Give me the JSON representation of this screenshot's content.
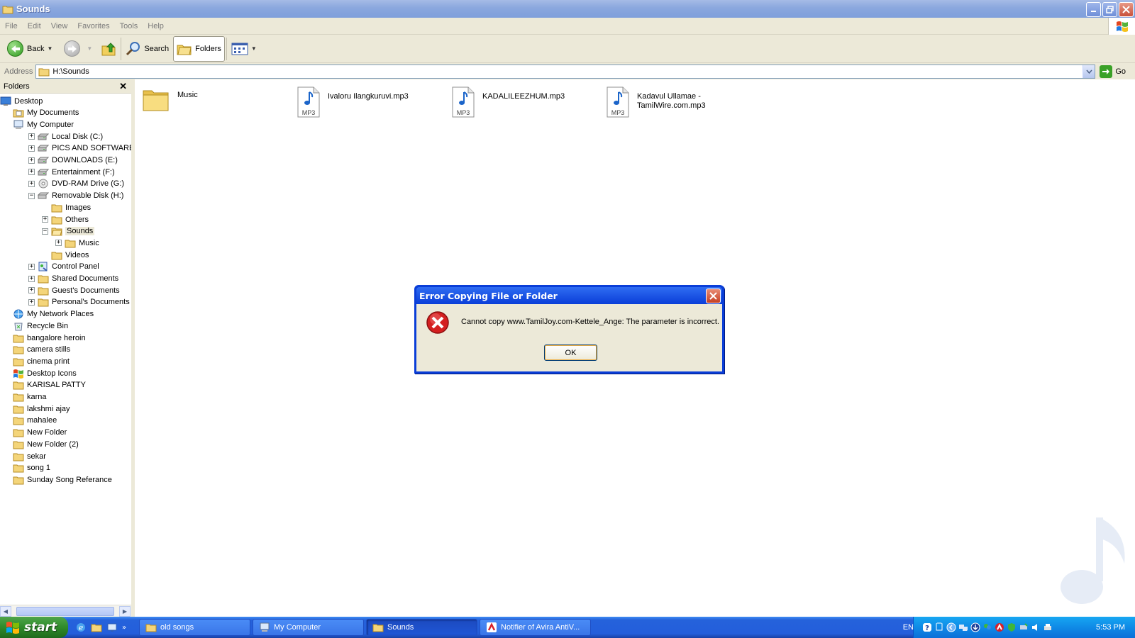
{
  "window": {
    "title": "Sounds",
    "menu": [
      "File",
      "Edit",
      "View",
      "Favorites",
      "Tools",
      "Help"
    ]
  },
  "toolbar": {
    "back_label": "Back",
    "search_label": "Search",
    "folders_label": "Folders"
  },
  "address": {
    "label": "Address",
    "value": "H:\\Sounds",
    "go_label": "Go"
  },
  "folders_pane": {
    "title": "Folders",
    "close_glyph": "✕",
    "items": [
      {
        "label": "Desktop",
        "icon": "desktop-icon",
        "expander": "",
        "level": 0
      },
      {
        "label": "My Documents",
        "icon": "my-documents-icon",
        "expander": "",
        "level": 1
      },
      {
        "label": "My Computer",
        "icon": "my-computer-icon",
        "expander": "",
        "level": 1
      },
      {
        "label": "Local Disk (C:)",
        "icon": "hard-drive-icon",
        "expander": "+",
        "level": 2
      },
      {
        "label": "PICS AND SOFTWARES (D:)",
        "icon": "hard-drive-icon",
        "expander": "+",
        "level": 2
      },
      {
        "label": "DOWNLOADS (E:)",
        "icon": "hard-drive-icon",
        "expander": "+",
        "level": 2
      },
      {
        "label": "Entertainment (F:)",
        "icon": "hard-drive-icon",
        "expander": "+",
        "level": 2
      },
      {
        "label": "DVD-RAM Drive (G:)",
        "icon": "dvd-drive-icon",
        "expander": "+",
        "level": 2
      },
      {
        "label": "Removable Disk (H:)",
        "icon": "removable-disk-icon",
        "expander": "−",
        "level": 2
      },
      {
        "label": "Images",
        "icon": "folder-icon",
        "expander": "",
        "level": 3
      },
      {
        "label": "Others",
        "icon": "folder-icon",
        "expander": "+",
        "level": 3
      },
      {
        "label": "Sounds",
        "icon": "folder-open-icon",
        "expander": "−",
        "level": 3
      },
      {
        "label": "Music",
        "icon": "folder-icon",
        "expander": "+",
        "level": 4
      },
      {
        "label": "Videos",
        "icon": "folder-icon",
        "expander": "",
        "level": 3
      },
      {
        "label": "Control Panel",
        "icon": "control-panel-icon",
        "expander": "+",
        "level": 2
      },
      {
        "label": "Shared Documents",
        "icon": "folder-icon",
        "expander": "+",
        "level": 2
      },
      {
        "label": "Guest's Documents",
        "icon": "folder-icon",
        "expander": "+",
        "level": 2
      },
      {
        "label": "Personal's Documents",
        "icon": "folder-icon",
        "expander": "+",
        "level": 2
      },
      {
        "label": "My Network Places",
        "icon": "network-places-icon",
        "expander": "",
        "level": 1
      },
      {
        "label": "Recycle Bin",
        "icon": "recycle-bin-icon",
        "expander": "",
        "level": 1
      },
      {
        "label": "bangalore heroin",
        "icon": "folder-icon",
        "expander": "",
        "level": 1
      },
      {
        "label": "camera stills",
        "icon": "folder-icon",
        "expander": "",
        "level": 1
      },
      {
        "label": "cinema print",
        "icon": "folder-icon",
        "expander": "",
        "level": 1
      },
      {
        "label": "Desktop Icons",
        "icon": "desktop-icons-icon",
        "expander": "",
        "level": 1
      },
      {
        "label": "KARISAL PATTY",
        "icon": "folder-icon",
        "expander": "",
        "level": 1
      },
      {
        "label": "karna",
        "icon": "folder-icon",
        "expander": "",
        "level": 1
      },
      {
        "label": "lakshmi ajay",
        "icon": "folder-icon",
        "expander": "",
        "level": 1
      },
      {
        "label": "mahalee",
        "icon": "folder-icon",
        "expander": "",
        "level": 1
      },
      {
        "label": "New Folder",
        "icon": "folder-icon",
        "expander": "",
        "level": 1
      },
      {
        "label": "New Folder (2)",
        "icon": "folder-icon",
        "expander": "",
        "level": 1
      },
      {
        "label": "sekar",
        "icon": "folder-icon",
        "expander": "",
        "level": 1
      },
      {
        "label": "song 1",
        "icon": "folder-icon",
        "expander": "",
        "level": 1
      },
      {
        "label": "Sunday Song Referance",
        "icon": "folder-icon",
        "expander": "",
        "level": 1
      }
    ]
  },
  "files": [
    {
      "name": "Music",
      "type": "folder",
      "icon": "folder-icon"
    },
    {
      "name": "Ivaloru Ilangkuruvi.mp3",
      "type": "mp3",
      "icon": "mp3-file-icon",
      "badge": "MP3"
    },
    {
      "name": "KADALILEEZHUM.mp3",
      "type": "mp3",
      "icon": "mp3-file-icon",
      "badge": "MP3"
    },
    {
      "name": "Kadavul Ullamae - TamilWire.com.mp3",
      "type": "mp3",
      "icon": "mp3-file-icon",
      "badge": "MP3"
    }
  ],
  "dialog": {
    "title": "Error Copying File or Folder",
    "message": "Cannot copy www.TamilJoy.com-Kettele_Ange: The parameter is incorrect.",
    "ok_label": "OK",
    "icon": "error-icon"
  },
  "taskbar": {
    "start_label": "start",
    "tasks": [
      {
        "label": "old songs",
        "icon": "folder-icon",
        "active": false
      },
      {
        "label": "My Computer",
        "icon": "my-computer-icon",
        "active": false
      },
      {
        "label": "Sounds",
        "icon": "folder-icon",
        "active": true
      },
      {
        "label": "Notifier of Avira AntiV...",
        "icon": "avira-icon",
        "active": false
      }
    ],
    "language": "EN",
    "clock": "5:53 PM"
  },
  "colors": {
    "title_bar": "#8aa7de",
    "dialog_title": "#0a3ed8",
    "taskbar": "#245edb",
    "start_button": "#2f8a2b",
    "tray": "#0f8ae6",
    "error_red": "#d41f1f"
  }
}
